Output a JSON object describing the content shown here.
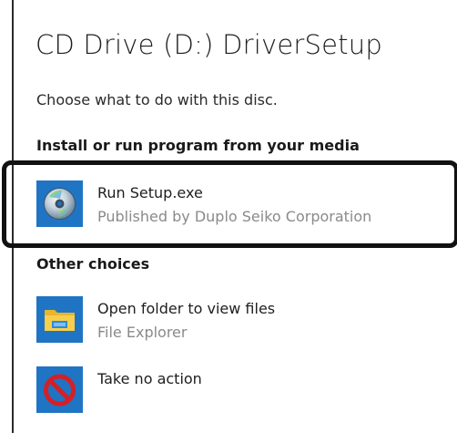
{
  "dialog": {
    "title": "CD Drive (D:) DriverSetup",
    "subtitle": "Choose what to do with this disc."
  },
  "sections": {
    "install_heading": "Install or run program from your media",
    "other_heading": "Other choices"
  },
  "options": [
    {
      "label": "Run Setup.exe",
      "sublabel": "Published by Duplo Seiko Corporation",
      "icon": "disc-setup-icon"
    },
    {
      "label": "Open folder to view files",
      "sublabel": "File Explorer",
      "icon": "folder-icon"
    },
    {
      "label": "Take no action",
      "icon": "no-action-icon"
    }
  ],
  "colors": {
    "tile_blue": "#1f74c4",
    "folder_yellow": "#f5c334",
    "forbid_red": "#d32027"
  }
}
